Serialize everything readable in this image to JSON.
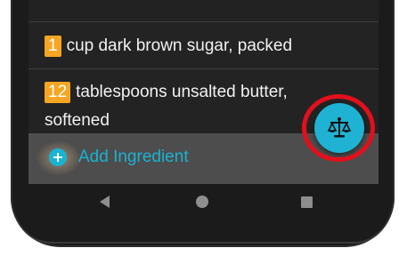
{
  "ingredients": [
    {
      "quantity": "1",
      "text": "cup dark brown sugar, packed"
    },
    {
      "quantity": "12",
      "text": "tablespoons unsalted butter, softened"
    }
  ],
  "add_bar": {
    "label": "Add Ingredient",
    "icon": "plus-circle-icon"
  },
  "fab": {
    "icon": "scale-icon",
    "highlighted": true
  },
  "nav": {
    "back_icon": "back-triangle-icon",
    "home_icon": "home-circle-icon",
    "recents_icon": "recents-square-icon"
  },
  "colors": {
    "quantity_badge": "#f6a623",
    "accent": "#1fb2d3",
    "highlight_ring": "#e2101c",
    "screen_bg": "#222222"
  }
}
